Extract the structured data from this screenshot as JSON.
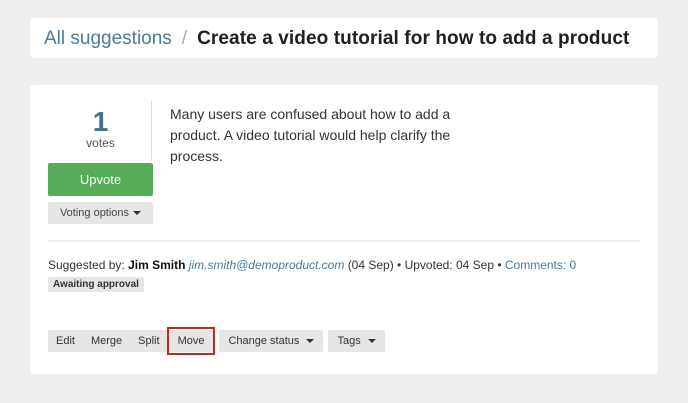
{
  "breadcrumb": {
    "link": "All suggestions",
    "separator": "/",
    "current": "Create a video tutorial for how to add a product"
  },
  "votes": {
    "count": "1",
    "label": "votes",
    "upvote_label": "Upvote",
    "options_label": "Voting options"
  },
  "suggestion": {
    "description": "Many users are confused about how to add a product. A video tutorial would help clarify the process."
  },
  "meta": {
    "suggested_by_label": "Suggested by:",
    "author": "Jim Smith",
    "email": "jim.smith@demoproduct.com",
    "date": "(04 Sep) •",
    "upvoted": "Upvoted: 04 Sep •",
    "comments": "Comments: 0",
    "status": "Awaiting approval"
  },
  "actions": {
    "edit": "Edit",
    "merge": "Merge",
    "split": "Split",
    "move": "Move",
    "change_status": "Change status",
    "tags": "Tags"
  },
  "colors": {
    "accent_link": "#4a7a9c",
    "upvote_green": "#57ad57",
    "highlight_red": "#cc2222"
  }
}
